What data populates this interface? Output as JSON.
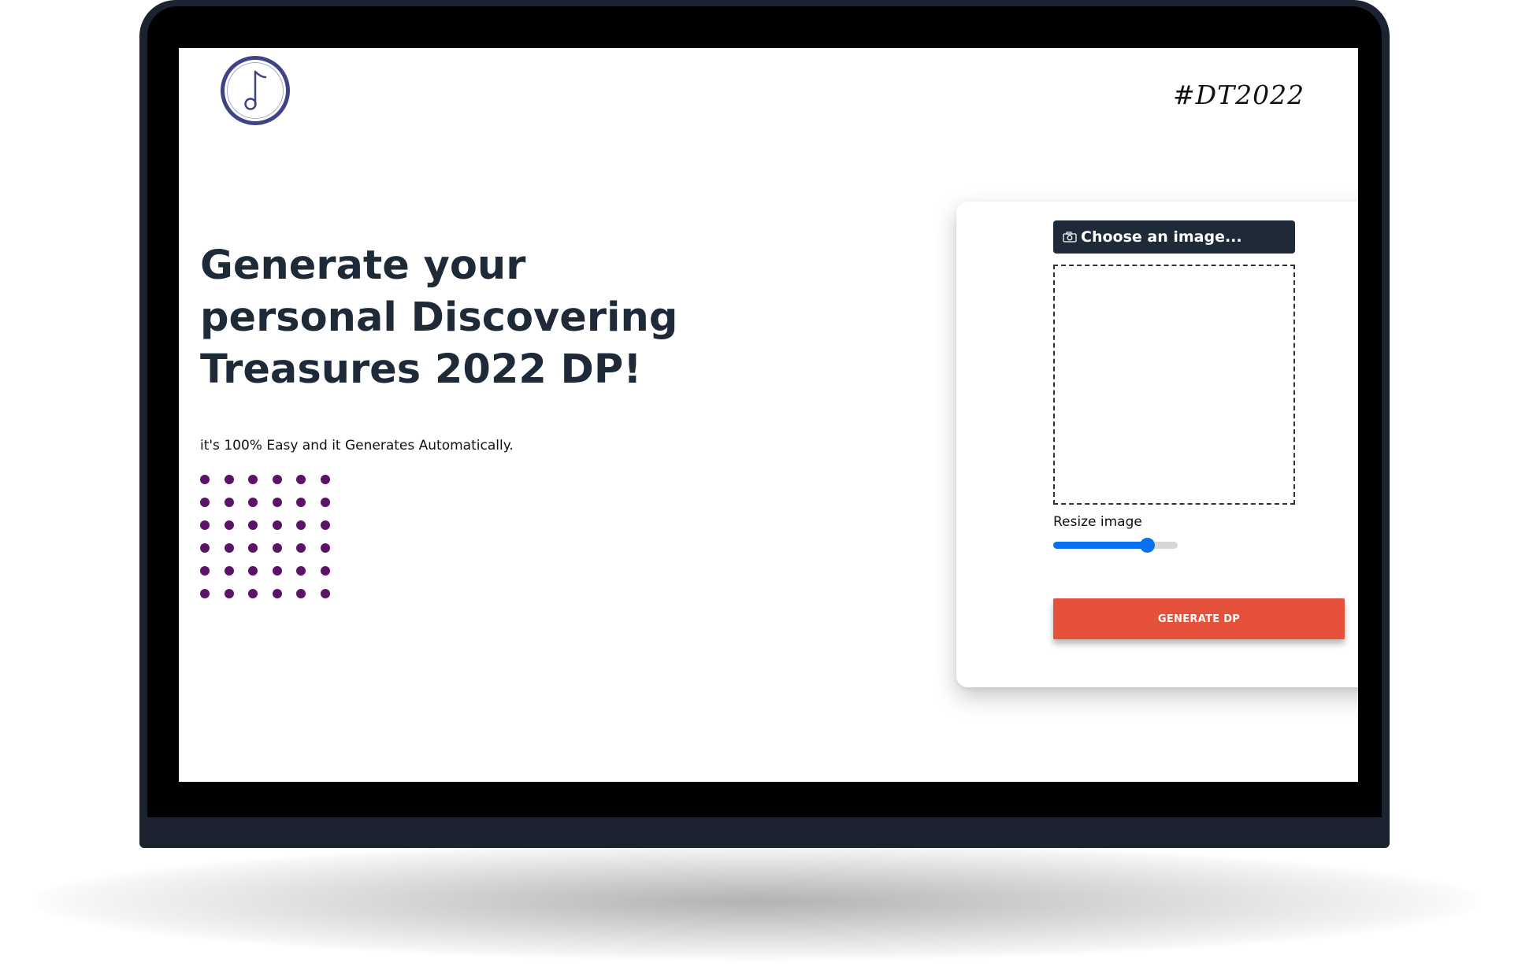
{
  "header": {
    "logo_icon": "circle-music-note-logo",
    "hashtag": "#DT2022"
  },
  "hero": {
    "headline": "Generate your personal Discovering Treasures 2022 DP!",
    "subtext": "it's 100% Easy and it Generates Automatically.",
    "dot_color": "#5b1268"
  },
  "generator": {
    "choose_icon": "camera-icon",
    "choose_label": "Choose an image...",
    "resize_label": "Resize image",
    "resize_value_fraction": 0.75,
    "generate_label": "GENERATE DP"
  },
  "colors": {
    "heading": "#1e2a38",
    "accent_button": "#e5513b",
    "slider": "#0a70f2",
    "frame": "#1b2230"
  }
}
